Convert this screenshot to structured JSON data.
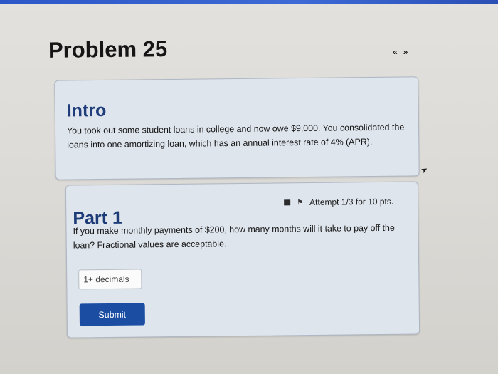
{
  "page": {
    "title": "Problem 25"
  },
  "nav": {
    "prev_icon": "double-chevron-left-icon",
    "next_icon": "double-chevron-right-icon",
    "prev_glyph": "«",
    "next_glyph": "»"
  },
  "intro": {
    "heading": "Intro",
    "text": "You took out some student loans in college and now owe $9,000. You consolidated the loans into one amortizing loan, which has an annual interest rate of 4% (APR)."
  },
  "part1": {
    "heading": "Part 1",
    "attempt": "Attempt 1/3 for 10 pts.",
    "question": "If you make monthly payments of $200, how many months will it take to pay off the loan? Fractional values are acceptable.",
    "input_placeholder": "1+ decimals",
    "input_value": "",
    "submit_label": "Submit"
  },
  "colors": {
    "accent": "#1b4ea3",
    "heading": "#1f3d7a",
    "card_bg": "#dfe5ed",
    "top_bar": "#2c57c7"
  }
}
